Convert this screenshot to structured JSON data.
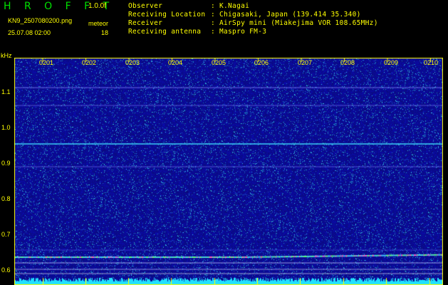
{
  "app": {
    "title": "H R O F F T",
    "version": "1.0.0f",
    "filename": "KN9_2507080200.png",
    "datetime": "25.07.08 02:00",
    "meteor_label": "meteor",
    "meteor_count": "18"
  },
  "info": [
    {
      "label": "Observer",
      "sep": ":",
      "value": "K.Nagai"
    },
    {
      "label": "Receiving Location",
      "sep": ":",
      "value": "Chigasaki, Japan (139.414 35.340)"
    },
    {
      "label": "Receiver",
      "sep": ":",
      "value": "AirSpy mini (Miakejima VOR 108.65MHz)"
    },
    {
      "label": "Receiving antenna",
      "sep": ":",
      "value": "Maspro FM-3"
    }
  ],
  "axis": {
    "y_unit": "kHz",
    "y_ticks": [
      "1.1",
      "1.0",
      "0.9",
      "0.8",
      "0.7",
      "0.6"
    ],
    "x_ticks": [
      "0201",
      "0202",
      "0203",
      "0204",
      "0205",
      "0206",
      "0207",
      "0208",
      "0209",
      "0210"
    ]
  },
  "colors": {
    "background": "#1010a0",
    "label": "#ffff00",
    "title": "#00e000",
    "carrier": "#40d0ff",
    "bottom_band": "#20e0ff"
  }
}
